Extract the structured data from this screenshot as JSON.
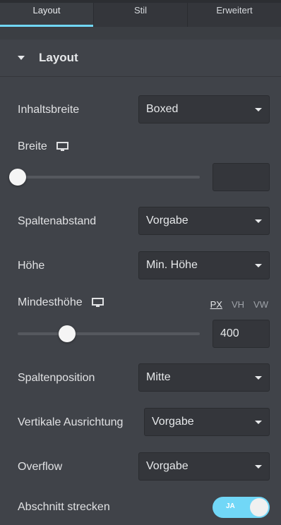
{
  "tabs": [
    {
      "label": "Layout",
      "active": true
    },
    {
      "label": "Stil",
      "active": false
    },
    {
      "label": "Erweitert",
      "active": false
    }
  ],
  "section": {
    "title": "Layout"
  },
  "fields": {
    "inhaltsbreite": {
      "label": "Inhaltsbreite",
      "value": "Boxed"
    },
    "breite": {
      "label": "Breite",
      "value": "",
      "slider_fraction": 0.0
    },
    "spaltenabstand": {
      "label": "Spaltenabstand",
      "value": "Vorgabe"
    },
    "hoehe": {
      "label": "Höhe",
      "value": "Min. Höhe"
    },
    "mindesthoehe": {
      "label": "Mindesthöhe",
      "value": "400",
      "units": [
        "PX",
        "VH",
        "VW"
      ],
      "active_unit": "PX",
      "slider_fraction": 0.27
    },
    "spaltenposition": {
      "label": "Spaltenposition",
      "value": "Mitte"
    },
    "vertikale": {
      "label": "Vertikale Ausrichtung",
      "value": "Vorgabe"
    },
    "overflow": {
      "label": "Overflow",
      "value": "Vorgabe"
    },
    "strecken": {
      "label": "Abschnitt strecken",
      "toggle_label": "JA",
      "on": true
    }
  },
  "colors": {
    "accent": "#71d7f7",
    "panel": "#404349",
    "control": "#34363b"
  }
}
